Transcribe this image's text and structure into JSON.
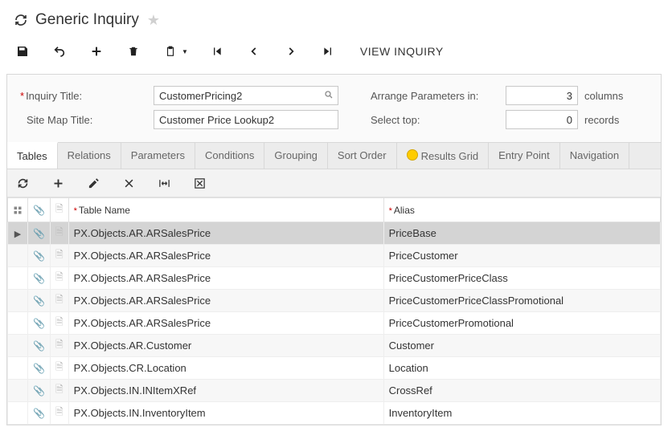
{
  "header": {
    "title": "Generic Inquiry"
  },
  "form": {
    "inquiry_title_label": "Inquiry Title:",
    "inquiry_title_value": "CustomerPricing2",
    "site_map_title_label": "Site Map Title:",
    "site_map_title_value": "Customer Price Lookup2",
    "arrange_label": "Arrange Parameters in:",
    "arrange_value": "3",
    "arrange_unit": "columns",
    "select_top_label": "Select top:",
    "select_top_value": "0",
    "select_top_unit": "records"
  },
  "tabs": [
    {
      "label": "Tables",
      "active": true
    },
    {
      "label": "Relations"
    },
    {
      "label": "Parameters"
    },
    {
      "label": "Conditions"
    },
    {
      "label": "Grouping"
    },
    {
      "label": "Sort Order"
    },
    {
      "label": "Results Grid",
      "warn": true
    },
    {
      "label": "Entry Point"
    },
    {
      "label": "Navigation"
    }
  ],
  "actions": {
    "view_inquiry": "VIEW INQUIRY"
  },
  "grid": {
    "columns": {
      "table_name": "Table Name",
      "alias": "Alias"
    },
    "rows": [
      {
        "table": "PX.Objects.AR.ARSalesPrice",
        "alias": "PriceBase",
        "selected": true
      },
      {
        "table": "PX.Objects.AR.ARSalesPrice",
        "alias": "PriceCustomer"
      },
      {
        "table": "PX.Objects.AR.ARSalesPrice",
        "alias": "PriceCustomerPriceClass"
      },
      {
        "table": "PX.Objects.AR.ARSalesPrice",
        "alias": "PriceCustomerPriceClassPromotional"
      },
      {
        "table": "PX.Objects.AR.ARSalesPrice",
        "alias": "PriceCustomerPromotional"
      },
      {
        "table": "PX.Objects.AR.Customer",
        "alias": "Customer"
      },
      {
        "table": "PX.Objects.CR.Location",
        "alias": "Location"
      },
      {
        "table": "PX.Objects.IN.INItemXRef",
        "alias": "CrossRef"
      },
      {
        "table": "PX.Objects.IN.InventoryItem",
        "alias": "InventoryItem"
      }
    ]
  }
}
